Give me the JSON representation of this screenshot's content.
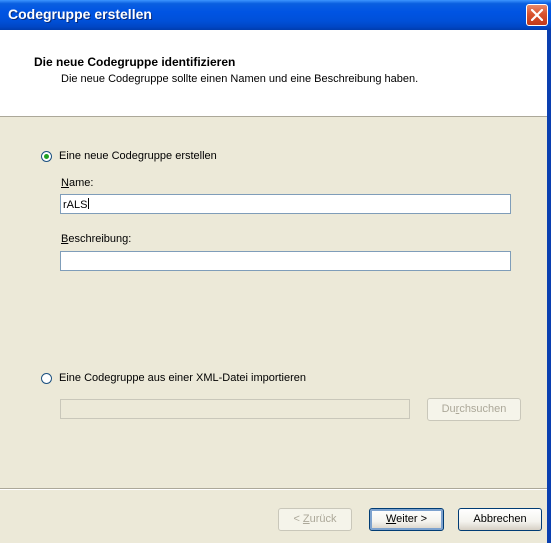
{
  "window": {
    "title": "Codegruppe erstellen"
  },
  "header": {
    "title": "Die neue Codegruppe identifizieren",
    "subtitle": "Die neue Codegruppe sollte einen Namen und eine Beschreibung haben."
  },
  "option_create": {
    "label": "Eine neue Codegruppe erstellen",
    "selected": true,
    "name_label": "Name:",
    "name_value": "rALS",
    "description_label": "Beschreibung:",
    "description_value": ""
  },
  "option_import": {
    "label": "Eine Codegruppe aus einer XML-Datei importieren",
    "selected": false,
    "path_value": "",
    "browse_label": "Durchsuchen"
  },
  "buttons": {
    "back": "< Zurück",
    "next": "Weiter >",
    "cancel": "Abbrechen"
  }
}
